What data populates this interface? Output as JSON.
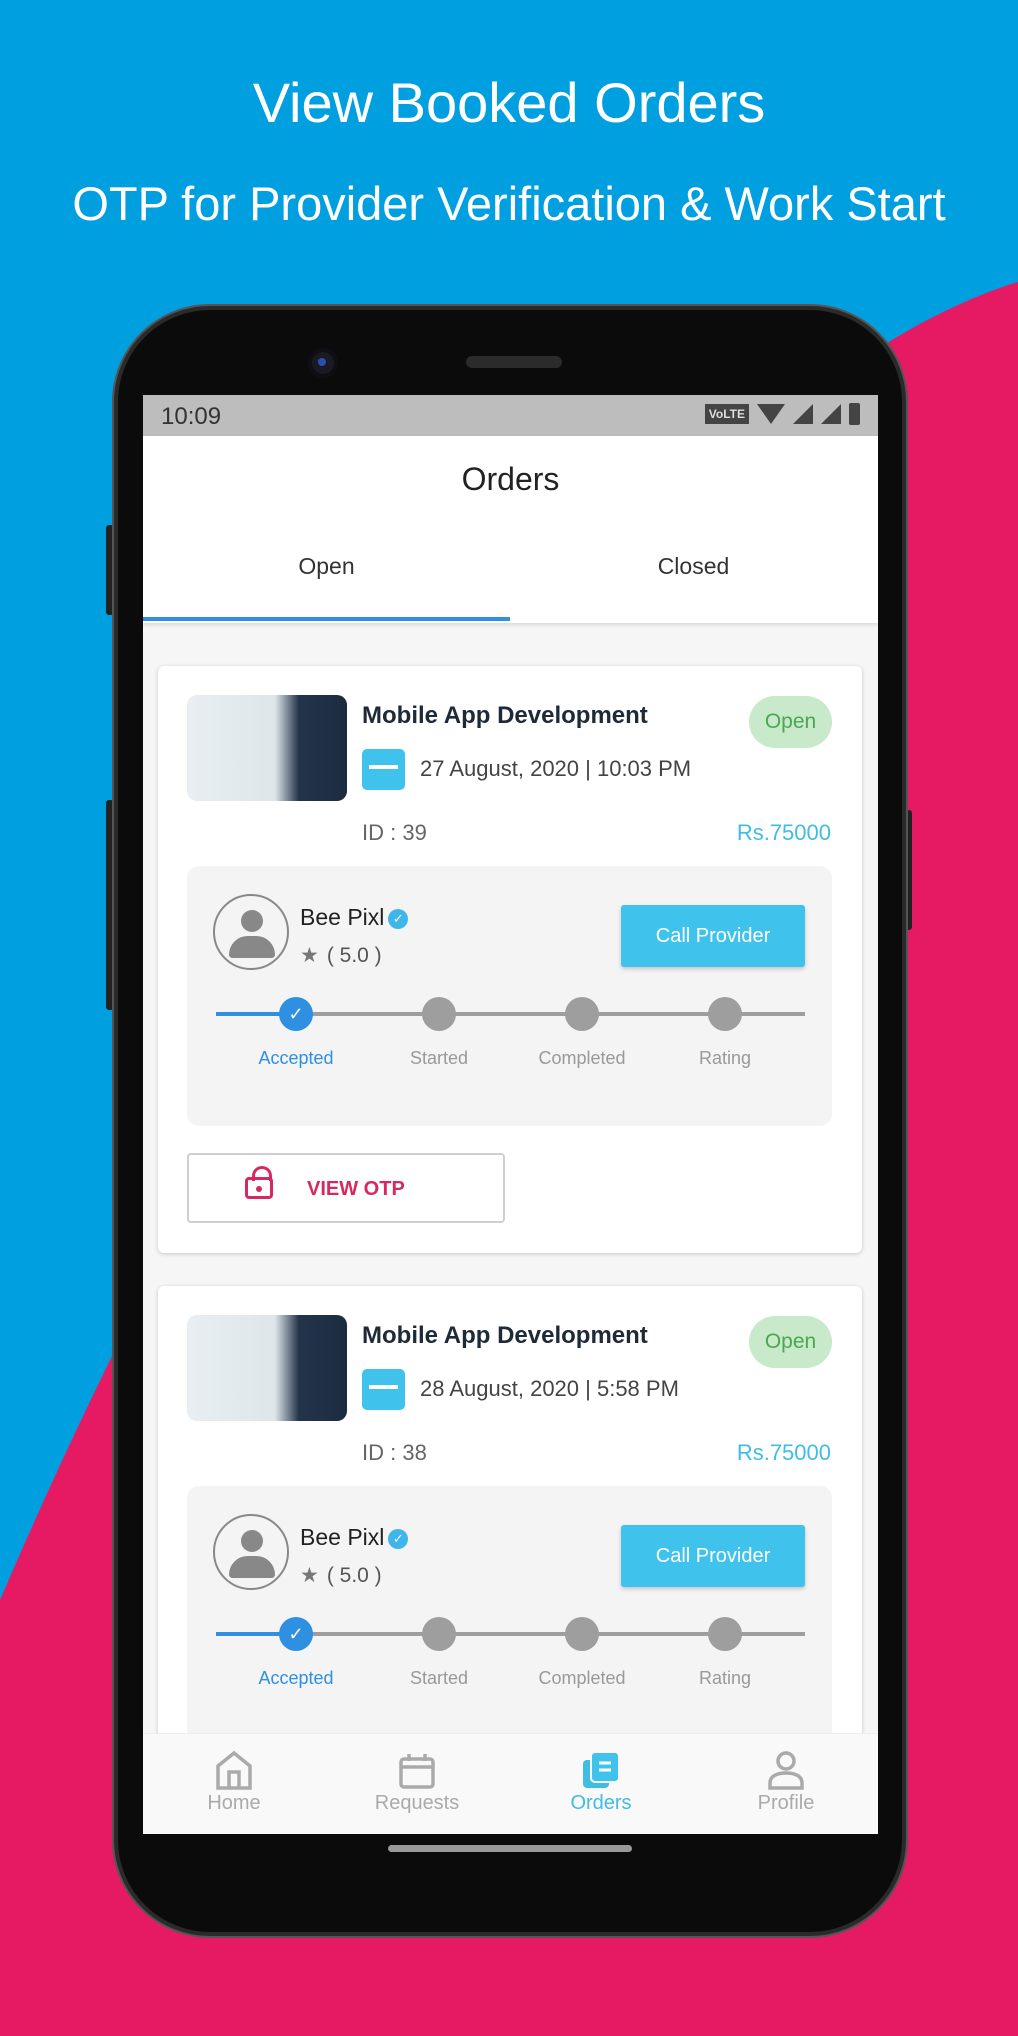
{
  "headline": "View Booked Orders",
  "subheadline": "OTP for Provider Verification & Work Start",
  "colors": {
    "background_blue": "#009fe0",
    "background_pink": "#e61a63",
    "accent": "#3fc3ec",
    "progress": "#2f8fe0",
    "otp": "#d72860"
  },
  "status_bar": {
    "time": "10:09",
    "volte": "VoLTE"
  },
  "header": {
    "title": "Orders"
  },
  "tabs": [
    {
      "label": "Open",
      "active": true
    },
    {
      "label": "Closed",
      "active": false
    }
  ],
  "orders": [
    {
      "title": "Mobile App Development",
      "date": "27 August, 2020 | 10:03 PM",
      "id": "ID : 39",
      "price": "Rs.75000",
      "status": "Open",
      "provider": {
        "name": "Bee Pixl",
        "rating": "( 5.0 )"
      },
      "call_label": "Call Provider",
      "steps": [
        "Accepted",
        "Started",
        "Completed",
        "Rating"
      ],
      "current_step": 1,
      "otp_label": "VIEW OTP"
    },
    {
      "title": "Mobile App Development",
      "date": "28 August, 2020 | 5:58 PM",
      "id": "ID : 38",
      "price": "Rs.75000",
      "status": "Open",
      "provider": {
        "name": "Bee Pixl",
        "rating": "( 5.0 )"
      },
      "call_label": "Call Provider",
      "steps": [
        "Accepted",
        "Started",
        "Completed",
        "Rating"
      ],
      "current_step": 1
    }
  ],
  "bottom_nav": [
    {
      "label": "Home",
      "icon": "home-icon"
    },
    {
      "label": "Requests",
      "icon": "calendar-icon"
    },
    {
      "label": "Orders",
      "icon": "orders-icon",
      "active": true
    },
    {
      "label": "Profile",
      "icon": "profile-icon"
    }
  ]
}
